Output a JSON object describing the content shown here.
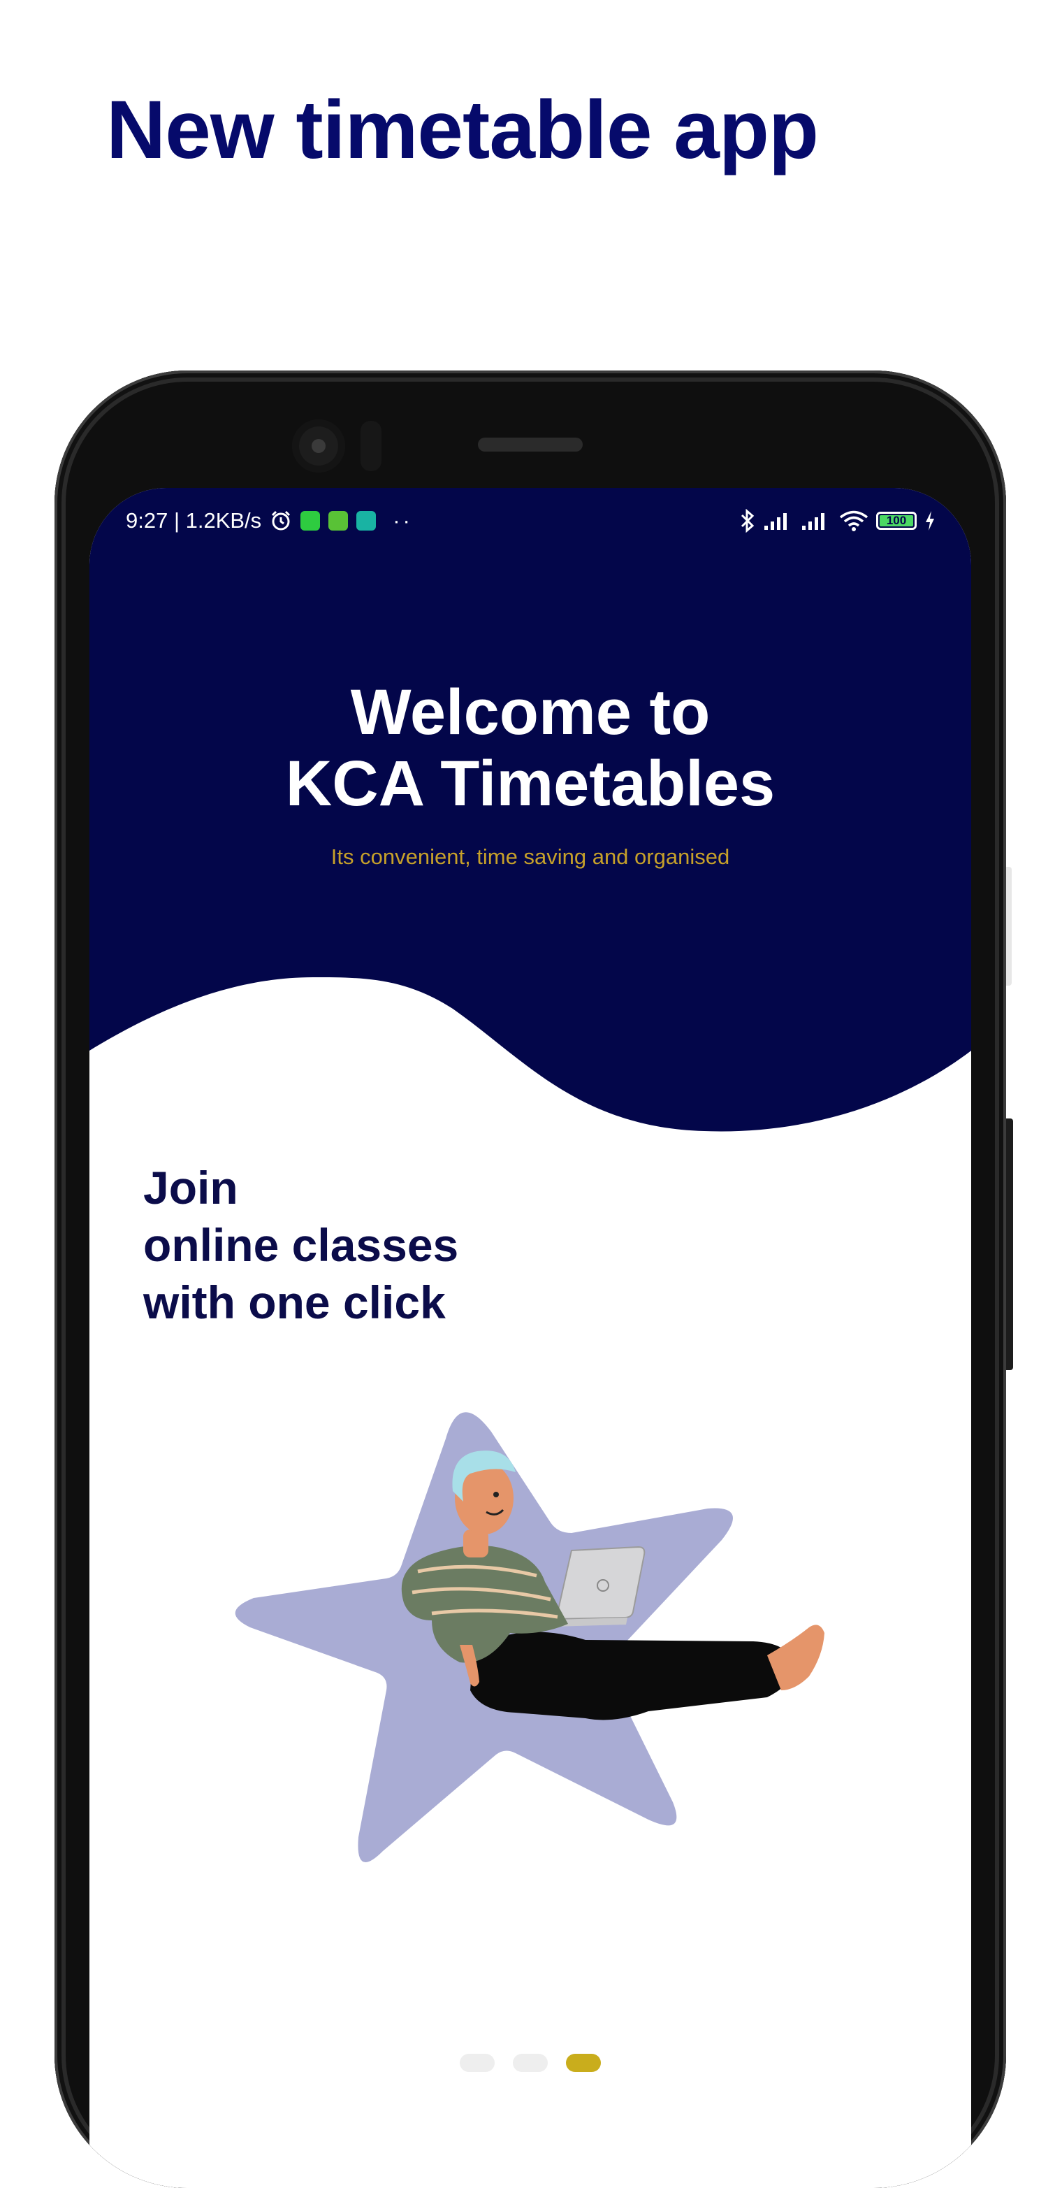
{
  "promo": {
    "title": "New timetable app"
  },
  "statusbar": {
    "time_speed": "9:27 | 1.2KB/s",
    "more_dots": "··",
    "battery": "100",
    "icons": [
      "alarm-icon",
      "whatsapp-icon",
      "android-app-icon",
      "shield-app-icon",
      "bluetooth-icon",
      "signal-icon",
      "signal-icon",
      "wifi-icon",
      "battery-icon",
      "charging-icon"
    ]
  },
  "hero": {
    "title_line1": "Welcome to",
    "title_line2": "KCA Timetables",
    "subtitle": "Its convenient, time saving and organised"
  },
  "onboarding": {
    "line1": "Join",
    "line2": "online classes",
    "line3": "with one click"
  },
  "pager": {
    "total": 3,
    "active_index": 2
  },
  "colors": {
    "brand_navy": "#03064a",
    "title_blue": "#060a6b",
    "accent_gold": "#c7a12a",
    "star_lavender": "#a9acd4"
  }
}
